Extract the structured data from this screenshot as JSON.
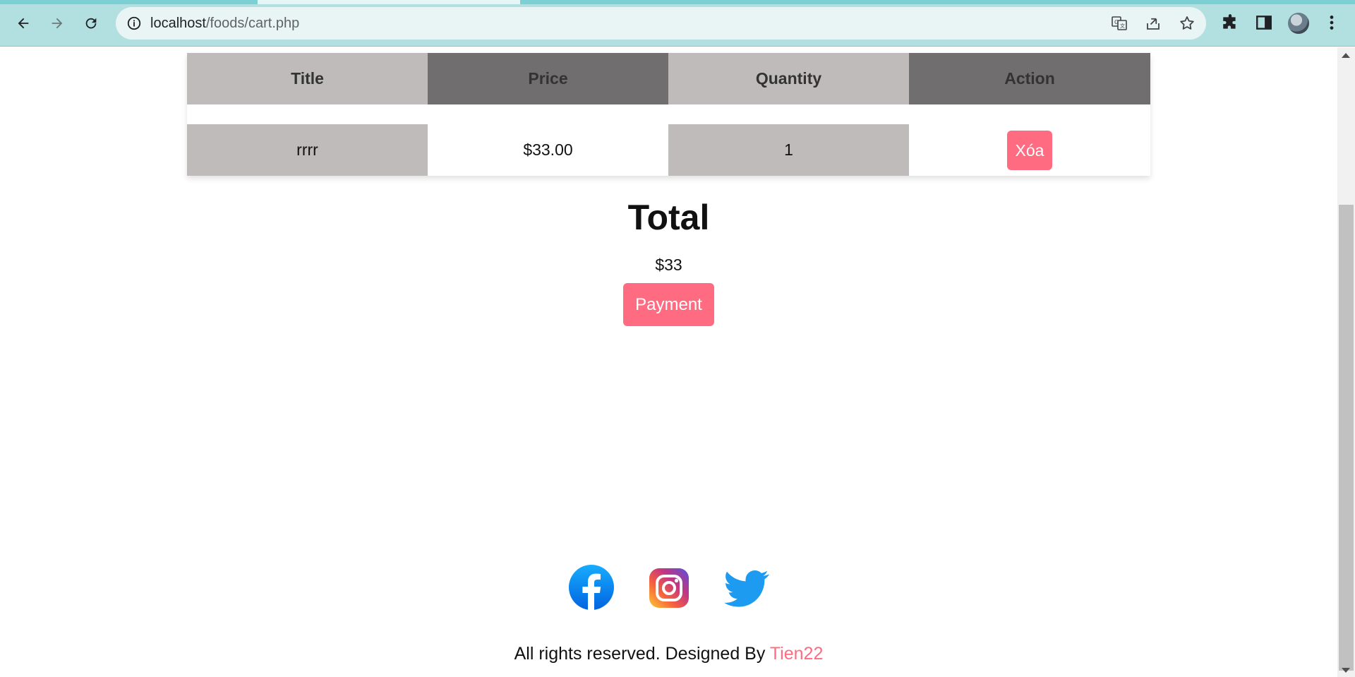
{
  "browser": {
    "url_host": "localhost",
    "url_path": "/foods/cart.php",
    "icons": [
      "back-icon",
      "forward-icon",
      "reload-icon",
      "site-info-icon",
      "translate-icon",
      "share-icon",
      "bookmark-star-icon",
      "extensions-icon",
      "side-panel-icon",
      "profile-avatar",
      "kebab-menu-icon"
    ]
  },
  "cart": {
    "headers": [
      "Title",
      "Price",
      "Quantity",
      "Action"
    ],
    "rows": [
      {
        "title": "rrrr",
        "price": "$33.00",
        "quantity": "1",
        "action": "Xóa"
      }
    ]
  },
  "total": {
    "heading": "Total",
    "amount": "$33",
    "payment_label": "Payment"
  },
  "footer": {
    "social": [
      "facebook-icon",
      "instagram-icon",
      "twitter-icon"
    ],
    "text": "All rights reserved. Designed By ",
    "author": "Tien22"
  },
  "colors": {
    "accent": "#ff6b81",
    "header_light": "#c0bbbb",
    "header_dark": "#706e6f",
    "chrome": "#b2dfe0"
  }
}
